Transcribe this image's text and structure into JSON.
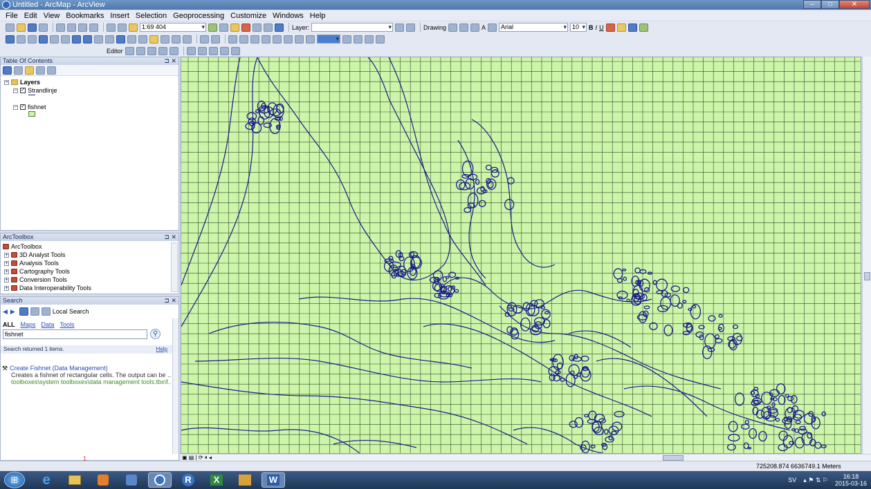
{
  "window": {
    "title": "Untitled - ArcMap - ArcView",
    "minimize": "–",
    "maximize": "□",
    "close": "✕"
  },
  "menu": [
    "File",
    "Edit",
    "View",
    "Bookmarks",
    "Insert",
    "Selection",
    "Geoprocessing",
    "Customize",
    "Windows",
    "Help"
  ],
  "toolbar": {
    "scale": "1:69 404",
    "layer_label": "Layer:",
    "drawing_label": "Drawing",
    "font_name": "Arial",
    "font_size": "10",
    "bold": "B",
    "italic": "I",
    "underline": "U",
    "text_tool": "A",
    "editor_label": "Editor"
  },
  "toc": {
    "title": "Table Of Contents",
    "root": "Layers",
    "layers": [
      {
        "name": "Strandlinje",
        "checked": true
      },
      {
        "name": "fishnet",
        "checked": true
      }
    ]
  },
  "arctoolbox": {
    "title": "ArcToolbox",
    "root": "ArcToolbox",
    "items": [
      "3D Analyst Tools",
      "Analysis Tools",
      "Cartography Tools",
      "Conversion Tools",
      "Data Interoperability Tools"
    ]
  },
  "search": {
    "title": "Search",
    "scope": "Local Search",
    "filters": [
      "ALL",
      "Maps",
      "Data",
      "Tools"
    ],
    "query": "fishnet",
    "summary": "Search returned 1 items.",
    "help_link": "Help",
    "result_title": "Create Fishnet (Data Management)",
    "result_desc": "Creates a fishnet of rectangular cells. The output can be ...",
    "result_path": "toolboxes\\system toolboxes\\data management tools.tbx\\f...",
    "page_number": "1"
  },
  "status": {
    "coordinates": "725208.874  6636749.1 Meters"
  },
  "taskbar": {
    "apps": [
      "IE",
      "Explorer",
      "Media",
      "Organizer",
      "ArcMap",
      "R",
      "Excel",
      "Package",
      "Word"
    ],
    "word_label": "W",
    "r_label": "R",
    "excel_label": "X"
  },
  "tray": {
    "lang": "SV",
    "time": "16:18",
    "date": "2015-03-16"
  },
  "colors": {
    "map_fill": "#cdf5a9",
    "grid": "#2f4a2a",
    "coastline": "#1a1a8a"
  }
}
